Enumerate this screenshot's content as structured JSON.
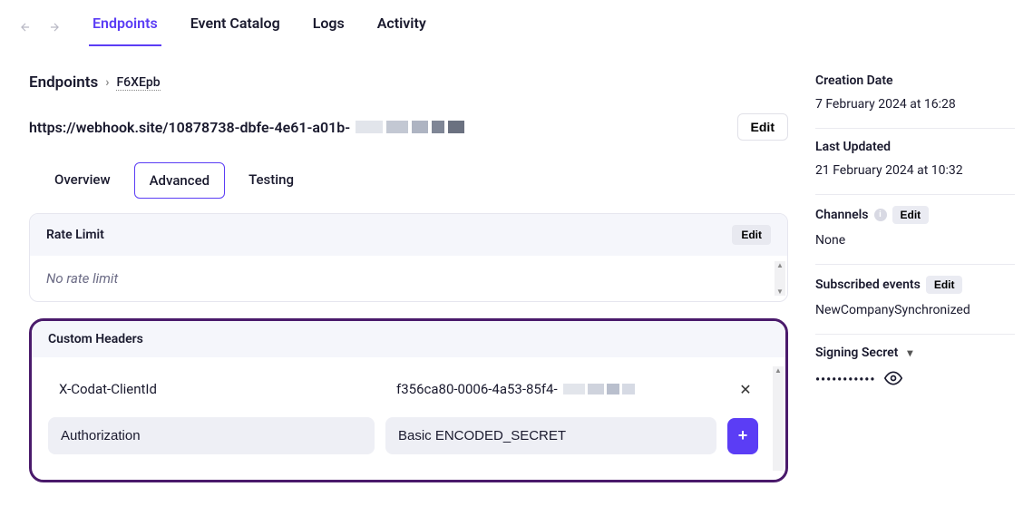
{
  "nav": {
    "tabs": [
      "Endpoints",
      "Event Catalog",
      "Logs",
      "Activity"
    ],
    "active": 0
  },
  "breadcrumb": {
    "root": "Endpoints",
    "id": "F6XEpb"
  },
  "endpoint": {
    "url": "https://webhook.site/10878738-dbfe-4e61-a01b-",
    "edit_label": "Edit"
  },
  "subtabs": {
    "items": [
      "Overview",
      "Advanced",
      "Testing"
    ],
    "active": 1
  },
  "rate_limit": {
    "title": "Rate Limit",
    "edit_label": "Edit",
    "body": "No rate limit"
  },
  "custom_headers": {
    "title": "Custom Headers",
    "rows": [
      {
        "key": "X-Codat-ClientId",
        "value": "f356ca80-0006-4a53-85f4-"
      }
    ],
    "new": {
      "key": "Authorization",
      "value": "Basic ENCODED_SECRET"
    }
  },
  "side": {
    "creation": {
      "label": "Creation Date",
      "value": "7 February 2024 at 16:28"
    },
    "updated": {
      "label": "Last Updated",
      "value": "21 February 2024 at 10:32"
    },
    "channels": {
      "label": "Channels",
      "edit": "Edit",
      "value": "None"
    },
    "subscribed": {
      "label": "Subscribed events",
      "edit": "Edit",
      "value": "NewCompanySynchronized"
    },
    "signing": {
      "label": "Signing Secret",
      "dots": "•••••••••••"
    }
  }
}
